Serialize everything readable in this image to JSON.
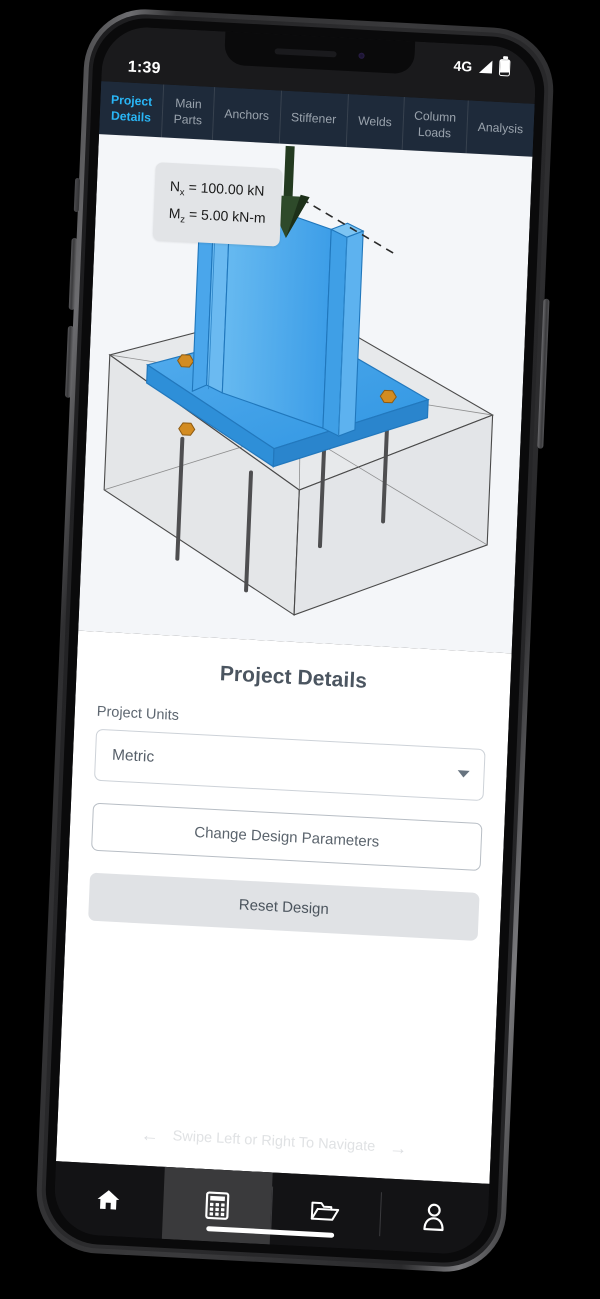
{
  "status_bar": {
    "time": "1:39",
    "network": "4G",
    "signal_icon": "signal-triangle-icon",
    "battery_icon": "battery-icon"
  },
  "tabs": [
    {
      "label": "Project\nDetails",
      "active": true
    },
    {
      "label": "Main\nParts",
      "active": false
    },
    {
      "label": "Anchors",
      "active": false
    },
    {
      "label": "Stiffener",
      "active": false
    },
    {
      "label": "Welds",
      "active": false
    },
    {
      "label": "Column\nLoads",
      "active": false
    },
    {
      "label": "Analysis",
      "active": false
    }
  ],
  "viewer": {
    "load_label": {
      "axial_symbol": "N",
      "axial_sub": "x",
      "axial_text": " = 100.00 kN",
      "moment_symbol": "M",
      "moment_sub": "z",
      "moment_text": " = 5.00 kN-m"
    },
    "model_description": "3D steel column base plate connection with anchor bolts in concrete pedestal",
    "colors": {
      "plate": "#3fa0ea",
      "column": "#5bb4ef",
      "concrete": "#d9dadc",
      "anchor": "#c8821f",
      "load_arrow": "#2e4a2a",
      "background": "#f4f6f9"
    }
  },
  "panel": {
    "title": "Project Details",
    "units_label": "Project Units",
    "units_value": "Metric",
    "units_caret_icon": "chevron-down-icon",
    "change_params_label": "Change Design Parameters",
    "reset_label": "Reset Design",
    "swipe_hint": "Swipe Left or Right To Navigate",
    "swipe_left_icon": "arrow-left-icon",
    "swipe_right_icon": "arrow-right-icon"
  },
  "bottom_nav": [
    {
      "icon": "home-icon",
      "active": false
    },
    {
      "icon": "calculator-icon",
      "active": true
    },
    {
      "icon": "folder-open-icon",
      "active": false
    },
    {
      "icon": "person-icon",
      "active": false
    }
  ],
  "accent_color": "#29b6f6",
  "tabbar_color": "#1e2a3a"
}
